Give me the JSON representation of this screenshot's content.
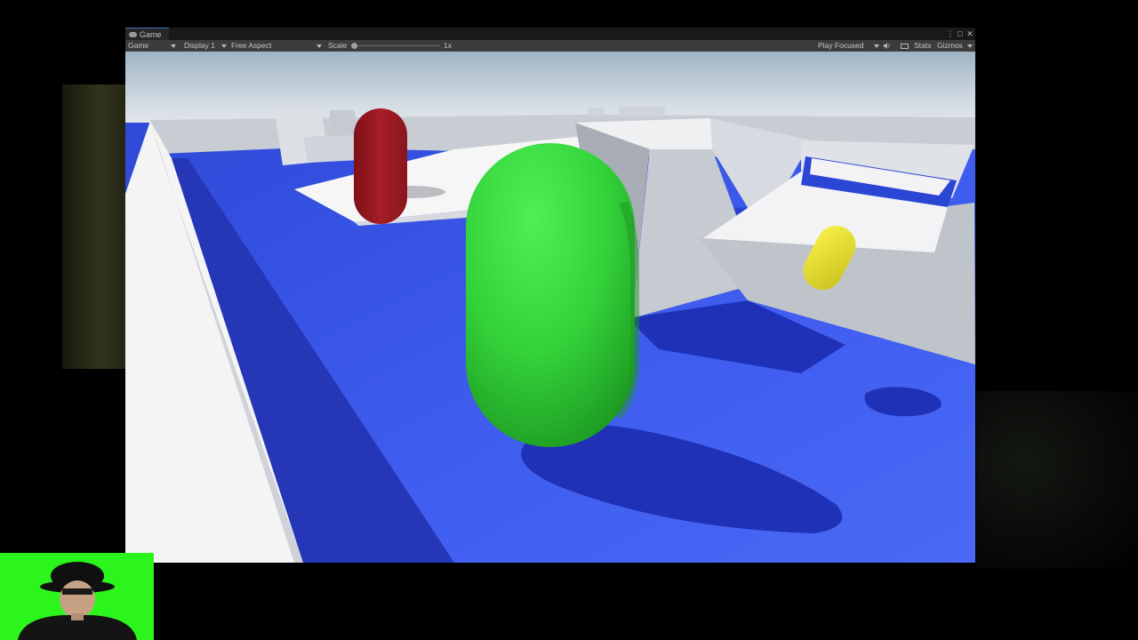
{
  "window": {
    "tab_label": "Game",
    "toolbar": {
      "game_mode": "Game",
      "display": "Display 1",
      "aspect": "Free Aspect",
      "scale_label": "Scale",
      "scale_value": "1x",
      "play_mode": "Play Focused",
      "stats": "Stats",
      "gizmos": "Gizmos"
    }
  },
  "colors": {
    "floor_blue": "#3f5ef0",
    "wall_white": "#f2f2f4",
    "player_green": "#34d23a",
    "enemy_red": "#a61e26",
    "pickup_yellow": "#f0e83a",
    "webcam_green": "#2cf51d"
  },
  "icons": [
    "gamepad-icon",
    "more-options-icon",
    "maximize-icon",
    "close-icon",
    "speaker-icon",
    "keyboard-icon"
  ]
}
